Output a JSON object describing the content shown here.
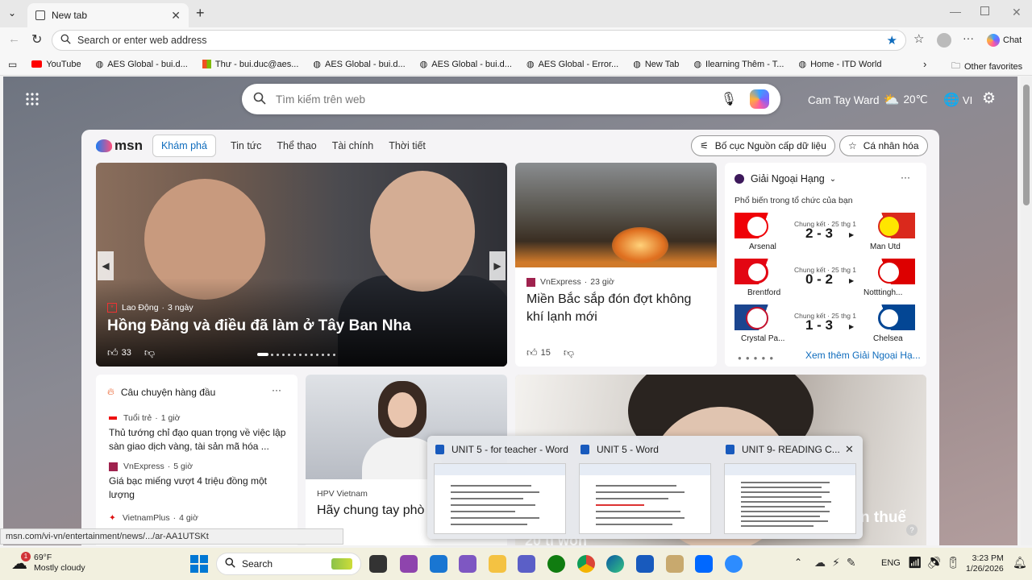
{
  "browser": {
    "tab_title": "New tab",
    "address_placeholder": "Search or enter web address",
    "chat_label": "Chat",
    "bookmarks": [
      "YouTube",
      "AES Global - bui.d...",
      "Thư - bui.duc@aes...",
      "AES Global - bui.d...",
      "AES Global - bui.d...",
      "AES Global - Error...",
      "New Tab",
      "Ilearning Thêm - T...",
      "Home - ITD World"
    ],
    "other_favorites": "Other favorites"
  },
  "newtab": {
    "search_placeholder": "Tìm kiếm trên web",
    "location": "Cam Tay Ward",
    "temperature": "20℃",
    "language": "VI"
  },
  "feed": {
    "logo": "msn",
    "nav": [
      "Khám phá",
      "Tin tức",
      "Thể thao",
      "Tài chính",
      "Thời tiết"
    ],
    "layout_button": "Bố cục Nguồn cấp dữ liệu",
    "personalize_button": "Cá nhân hóa",
    "hero": {
      "source": "Lao Động",
      "time": "3 ngày",
      "title": "Hồng Đăng và điều đã làm ở Tây Ban Nha",
      "likes": "33"
    },
    "story2": {
      "source": "VnExpress",
      "time": "23 giờ",
      "title": "Miền Bắc sắp đón đợt không khí lạnh mới",
      "likes": "15"
    },
    "league": {
      "name": "Giải Ngoại Hạng",
      "subtitle": "Phổ biến trong tổ chức của bạn",
      "matches": [
        {
          "status": "Chung kết · 25 thg 1",
          "home": "Arsenal",
          "away": "Man Utd",
          "score": "2 - 3"
        },
        {
          "status": "Chung kết · 25 thg 1",
          "home": "Brentford",
          "away": "Notttingh...",
          "score": "0 - 2"
        },
        {
          "status": "Chung kết · 25 thg 1",
          "home": "Crystal Pa...",
          "away": "Chelsea",
          "score": "1 - 3"
        }
      ],
      "more_link": "Xem thêm Giải Ngoại Hạ..."
    },
    "top_stories": {
      "title": "Câu chuyện hàng đầu",
      "items": [
        {
          "source": "Tuổi trẻ",
          "time": "1 giờ",
          "title": "Thủ tướng chỉ đạo quan trọng về việc lập sàn giao dịch vàng, tài sản mã hóa ..."
        },
        {
          "source": "VnExpress",
          "time": "5 giờ",
          "title": "Giá bạc miếng vượt 4 triệu đồng một lượng"
        },
        {
          "source": "VietnamPlus",
          "time": "4 giờ",
          "title": ""
        }
      ]
    },
    "story4": {
      "source": "HPV Vietnam",
      "title": "Hãy chung tay phò"
    },
    "story5": {
      "title_fragment": "n thuế",
      "bottom_fragment": "20 tỉ won"
    }
  },
  "preview": {
    "windows": [
      "UNIT 5 - for teacher - Word",
      "UNIT 5 - Word",
      "UNIT 9- READING C..."
    ]
  },
  "status_url": "msn.com/vi-vn/entertainment/news/.../ar-AA1UTSKt",
  "taskbar": {
    "weather_temp": "69°F",
    "weather_desc": "Mostly cloudy",
    "weather_badge": "1",
    "search_label": "Search",
    "lang": "ENG",
    "time": "3:23 PM",
    "date": "1/26/2026"
  },
  "colors": {
    "accent": "#0f6cbd",
    "copilot": "#7b61ff",
    "arsenal": "#ef0107",
    "chelsea": "#034694",
    "taskbar": "#f2f0df"
  }
}
